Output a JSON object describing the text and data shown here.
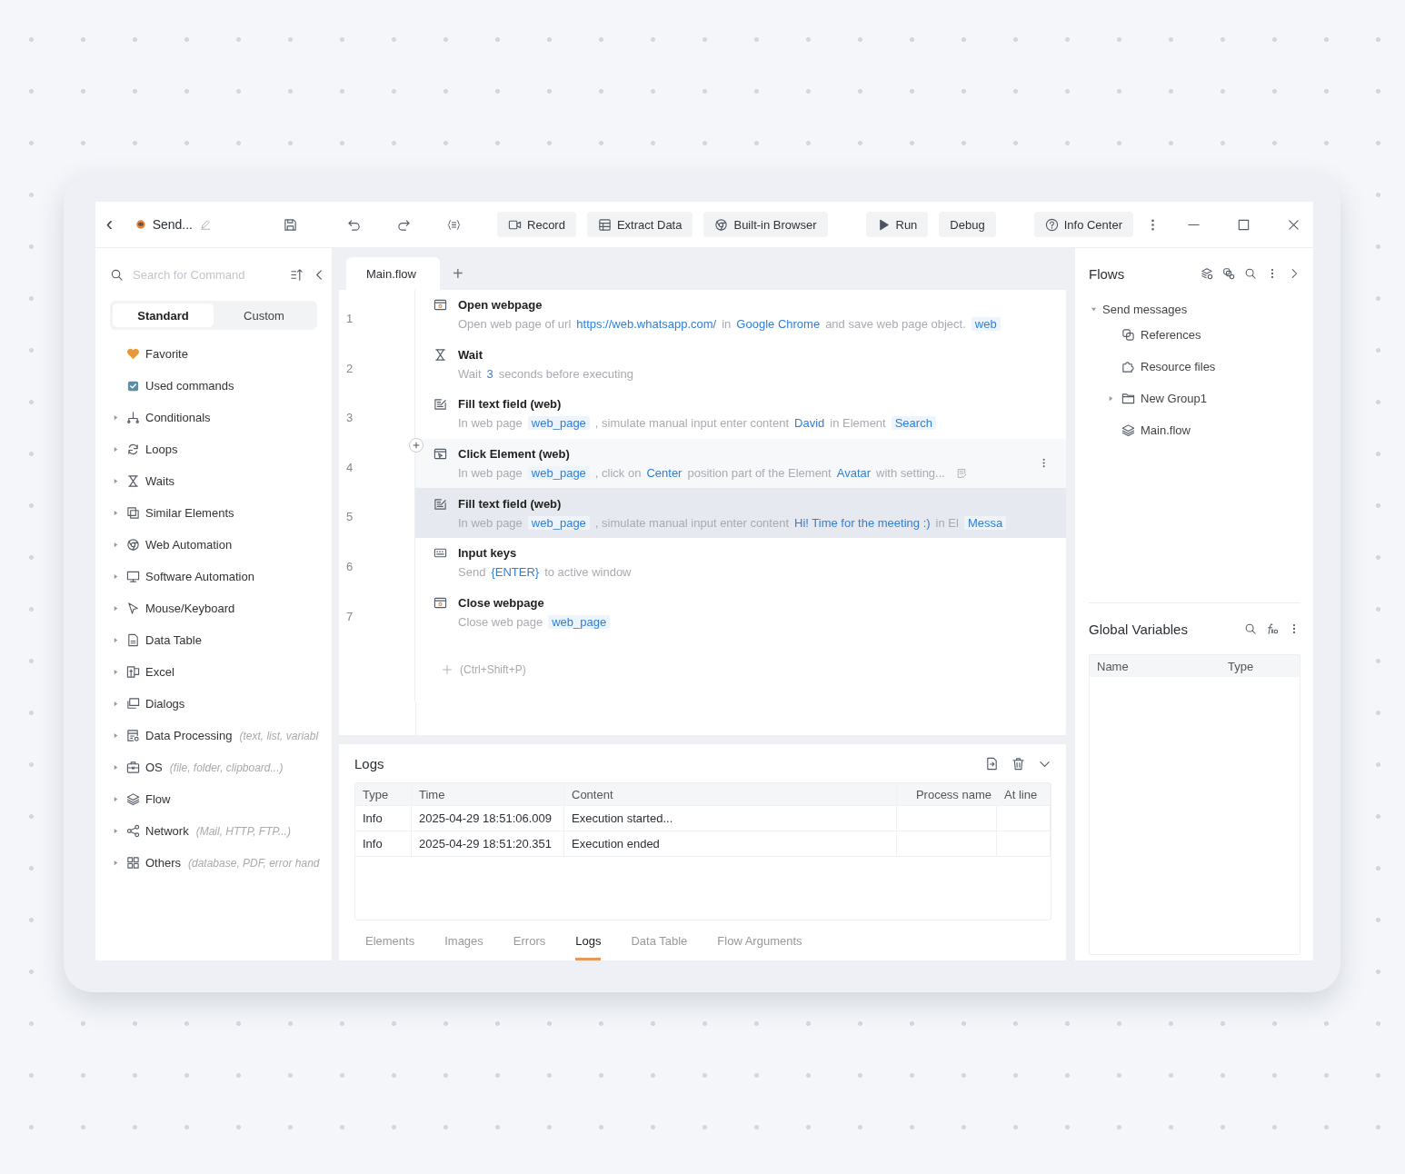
{
  "toolbar": {
    "back": "‹",
    "project_name": "Send...",
    "buttons": [
      {
        "label": "Record"
      },
      {
        "label": "Extract Data"
      },
      {
        "label": "Built-in Browser"
      }
    ],
    "run": "Run",
    "debug": "Debug",
    "info": "Info Center"
  },
  "sidebar": {
    "search": {
      "placeholder": "Search for Command"
    },
    "modes": [
      {
        "label": "Standard",
        "selected": true
      },
      {
        "label": "Custom",
        "selected": false
      }
    ],
    "items": [
      {
        "label": "Favorite",
        "kind": "pinned"
      },
      {
        "label": "Used commands",
        "kind": "pinned"
      },
      {
        "label": "Conditionals",
        "kind": "group"
      },
      {
        "label": "Loops",
        "kind": "group"
      },
      {
        "label": "Waits",
        "kind": "group"
      },
      {
        "label": "Similar Elements",
        "kind": "group"
      },
      {
        "label": "Web Automation",
        "kind": "group"
      },
      {
        "label": "Software Automation",
        "kind": "group"
      },
      {
        "label": "Mouse/Keyboard",
        "kind": "group"
      },
      {
        "label": "Data Table",
        "kind": "group"
      },
      {
        "label": "Excel",
        "kind": "group"
      },
      {
        "label": "Dialogs",
        "kind": "group"
      },
      {
        "label": "Data Processing",
        "kind": "group",
        "hint": "(text, list, variabl"
      },
      {
        "label": "OS",
        "kind": "group",
        "hint": "(file, folder, clipboard...)"
      },
      {
        "label": "Flow",
        "kind": "group"
      },
      {
        "label": "Network",
        "kind": "group",
        "hint": "(Mail, HTTP, FTP...)"
      },
      {
        "label": "Others",
        "kind": "group",
        "hint": "(database, PDF, error hand"
      }
    ]
  },
  "editor": {
    "tabs": [
      {
        "label": "Main.flow",
        "selected": true
      }
    ],
    "add_tab": "+",
    "steps": [
      {
        "line": "1",
        "title": "Open webpage",
        "selected": false,
        "hovered": false,
        "parts": [
          {
            "kind": "text",
            "text": "Open web page of url"
          },
          {
            "kind": "value",
            "text": "https://web.whatsapp.com/"
          },
          {
            "kind": "text",
            "text": "in"
          },
          {
            "kind": "value",
            "text": "Google Chrome"
          },
          {
            "kind": "text",
            "text": "and save web page object."
          },
          {
            "kind": "chip",
            "text": "web"
          }
        ]
      },
      {
        "line": "2",
        "title": "Wait",
        "selected": false,
        "hovered": false,
        "parts": [
          {
            "kind": "text",
            "text": "Wait"
          },
          {
            "kind": "value",
            "text": "3"
          },
          {
            "kind": "text",
            "text": "seconds before executing"
          }
        ]
      },
      {
        "line": "3",
        "title": "Fill text field (web)",
        "selected": false,
        "hovered": false,
        "parts": [
          {
            "kind": "text",
            "text": "In web page"
          },
          {
            "kind": "chip",
            "text": "web_page"
          },
          {
            "kind": "text",
            "text": ", simulate manual input enter content"
          },
          {
            "kind": "value",
            "text": "David"
          },
          {
            "kind": "text",
            "text": "in Element"
          },
          {
            "kind": "chip",
            "text": "Search"
          }
        ]
      },
      {
        "line": "4",
        "title": "Click Element (web)",
        "selected": false,
        "hovered": true,
        "parts": [
          {
            "kind": "text",
            "text": "In web page"
          },
          {
            "kind": "chip",
            "text": "web_page"
          },
          {
            "kind": "text",
            "text": ", click on"
          },
          {
            "kind": "value",
            "text": "Center"
          },
          {
            "kind": "text",
            "text": "position  part of the Element"
          },
          {
            "kind": "value",
            "text": "Avatar"
          },
          {
            "kind": "text",
            "text": "with setting..."
          }
        ]
      },
      {
        "line": "5",
        "title": "Fill text field (web)",
        "selected": true,
        "hovered": false,
        "parts": [
          {
            "kind": "text",
            "text": "In web page"
          },
          {
            "kind": "chip",
            "text": "web_page"
          },
          {
            "kind": "text",
            "text": ", simulate manual input enter content"
          },
          {
            "kind": "value",
            "text": "Hi! Time for the meeting :)"
          },
          {
            "kind": "text",
            "text": "in El"
          },
          {
            "kind": "chip",
            "text": "Messa"
          }
        ]
      },
      {
        "line": "6",
        "title": "Input keys",
        "selected": false,
        "hovered": false,
        "parts": [
          {
            "kind": "text",
            "text": "Send"
          },
          {
            "kind": "value",
            "text": "{ENTER}"
          },
          {
            "kind": "text",
            "text": "to active window"
          }
        ]
      },
      {
        "line": "7",
        "title": "Close webpage",
        "selected": false,
        "hovered": false,
        "parts": [
          {
            "kind": "text",
            "text": "Close web page"
          },
          {
            "kind": "chip",
            "text": "web_page"
          }
        ]
      }
    ],
    "add_hint": "(Ctrl+Shift+P)"
  },
  "logs": {
    "title": "Logs",
    "columns": [
      "Type",
      "Time",
      "Content",
      "Process name",
      "At line"
    ],
    "rows": [
      [
        "Info",
        "2025-04-29 18:51:06.009",
        "Execution started...",
        "",
        ""
      ],
      [
        "Info",
        "2025-04-29 18:51:20.351",
        "Execution ended",
        "",
        ""
      ]
    ],
    "tabs": [
      {
        "label": "Elements",
        "selected": false
      },
      {
        "label": "Images",
        "selected": false
      },
      {
        "label": "Errors",
        "selected": false
      },
      {
        "label": "Logs",
        "selected": true
      },
      {
        "label": "Data Table",
        "selected": false
      },
      {
        "label": "Flow Arguments",
        "selected": false
      }
    ]
  },
  "flows": {
    "title": "Flows",
    "root": {
      "label": "Send messages",
      "expanded": true,
      "children": [
        {
          "label": "References",
          "kind": "references"
        },
        {
          "label": "Resource files",
          "kind": "resources"
        },
        {
          "label": "New Group1",
          "kind": "folder",
          "expanded": false
        },
        {
          "label": "Main.flow",
          "kind": "flow"
        }
      ]
    }
  },
  "global_variables": {
    "title": "Global Variables",
    "columns": [
      "Name",
      "Type"
    ]
  }
}
